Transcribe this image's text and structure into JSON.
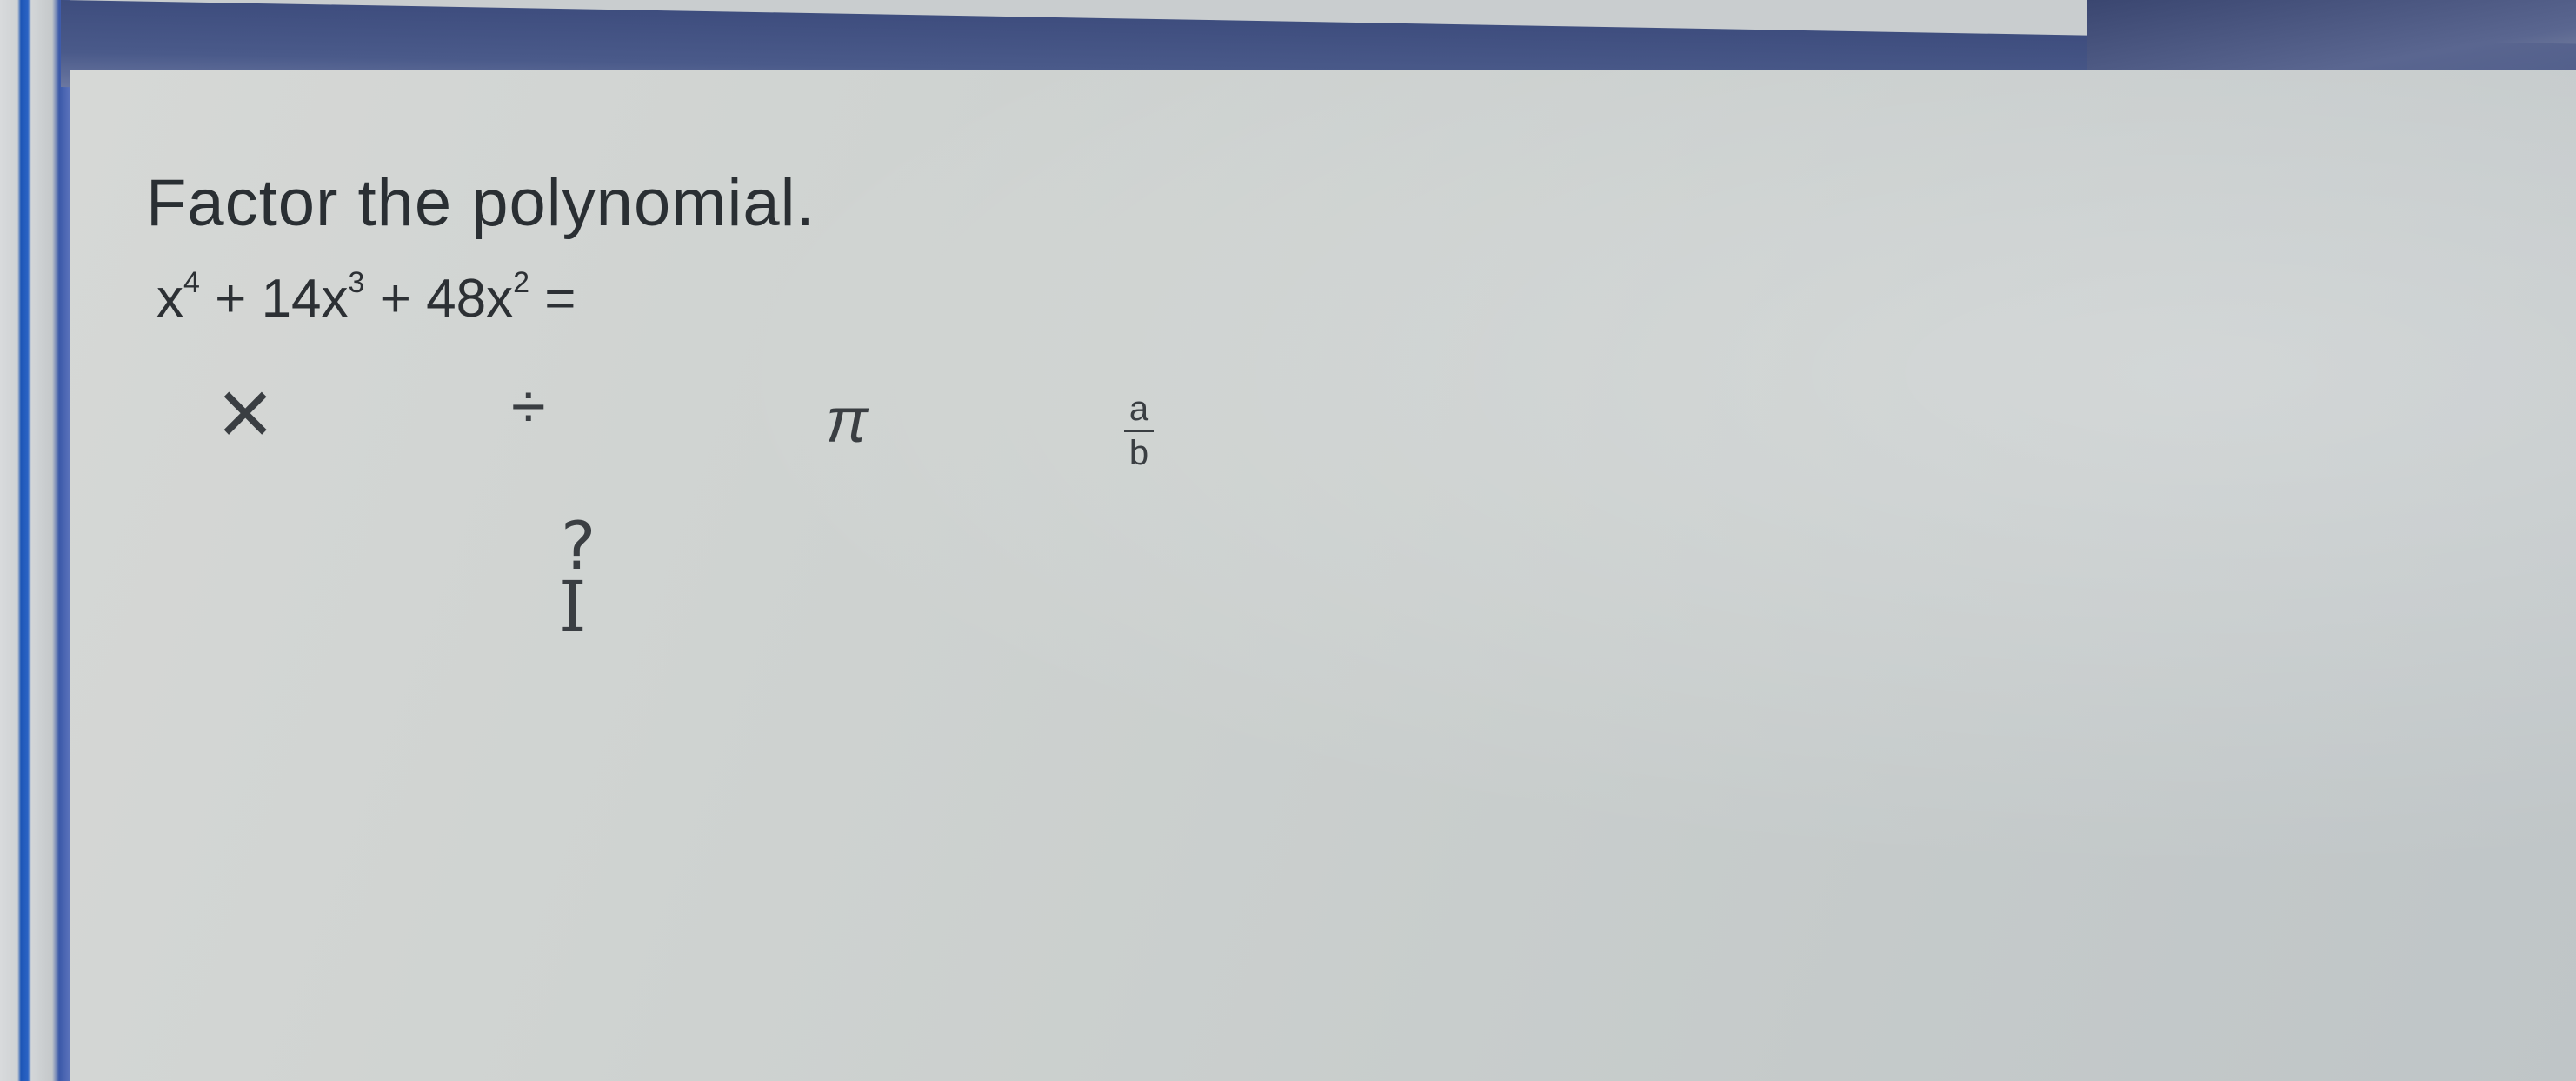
{
  "question": {
    "instruction": "Factor the polynomial.",
    "equation": {
      "term1_base": "x",
      "term1_exp": "4",
      "op1": " + 14x",
      "term2_exp": "3",
      "op2": " + 48x",
      "term3_exp": "2",
      "equals": " ="
    }
  },
  "toolbar": {
    "times": "×",
    "divide": "÷",
    "pi": "π",
    "fraction_numerator": "a",
    "fraction_denominator": "b",
    "help": "?"
  },
  "cursor": {
    "glyph": "I"
  },
  "colors": {
    "topbar": "#4a5a8a",
    "accent_blue": "#2a63c4",
    "text": "#2a2f33"
  }
}
